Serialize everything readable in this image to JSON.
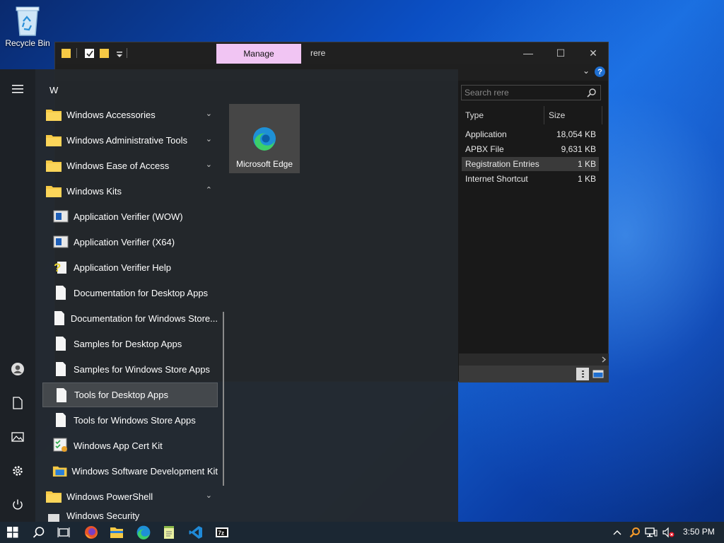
{
  "desktop": {
    "recycle_bin_label": "Recycle Bin"
  },
  "explorer": {
    "manage_tab": "Manage",
    "title": "rere",
    "search_placeholder": "Search rere",
    "columns": {
      "type": "Type",
      "size": "Size"
    },
    "rows": [
      {
        "type": "Application",
        "size": "18,054 KB"
      },
      {
        "type": "APBX File",
        "size": "9,631 KB"
      },
      {
        "type": "Registration Entries",
        "size": "1 KB"
      },
      {
        "type": "Internet Shortcut",
        "size": "1 KB"
      }
    ],
    "controls": {
      "minimize": "—",
      "maximize": "☐",
      "close": "✕",
      "help": "?",
      "chevron": "⌄"
    }
  },
  "start_menu": {
    "letter": "W",
    "items": [
      {
        "label": "Windows Accessories",
        "kind": "folder",
        "arrow": "⌄"
      },
      {
        "label": "Windows Administrative Tools",
        "kind": "folder",
        "arrow": "⌄"
      },
      {
        "label": "Windows Ease of Access",
        "kind": "folder",
        "arrow": "⌄"
      },
      {
        "label": "Windows Kits",
        "kind": "folder",
        "arrow": "⌃"
      },
      {
        "label": "Application Verifier (WOW)",
        "kind": "app-window"
      },
      {
        "label": "Application Verifier (X64)",
        "kind": "app-window"
      },
      {
        "label": "Application Verifier Help",
        "kind": "help"
      },
      {
        "label": "Documentation for Desktop Apps",
        "kind": "doc"
      },
      {
        "label": "Documentation for Windows Store...",
        "kind": "doc"
      },
      {
        "label": "Samples for Desktop Apps",
        "kind": "doc"
      },
      {
        "label": "Samples for Windows Store Apps",
        "kind": "doc"
      },
      {
        "label": "Tools for Desktop Apps",
        "kind": "doc"
      },
      {
        "label": "Tools for Windows Store Apps",
        "kind": "doc"
      },
      {
        "label": "Windows App Cert Kit",
        "kind": "cert"
      },
      {
        "label": "Windows Software Development Kit",
        "kind": "sdk"
      },
      {
        "label": "Windows PowerShell",
        "kind": "folder",
        "arrow": "⌄"
      },
      {
        "label": "Windows Security",
        "kind": "shield"
      }
    ],
    "highlighted_index": 11,
    "tile": {
      "label": "Microsoft Edge"
    }
  },
  "taskbar": {
    "time": "3:50 PM"
  },
  "colors": {
    "manage_tab": "#f1c5f3",
    "folder": "#f6c945",
    "edge_blue": "#1e90d6",
    "edge_green": "#3ccf6a"
  }
}
